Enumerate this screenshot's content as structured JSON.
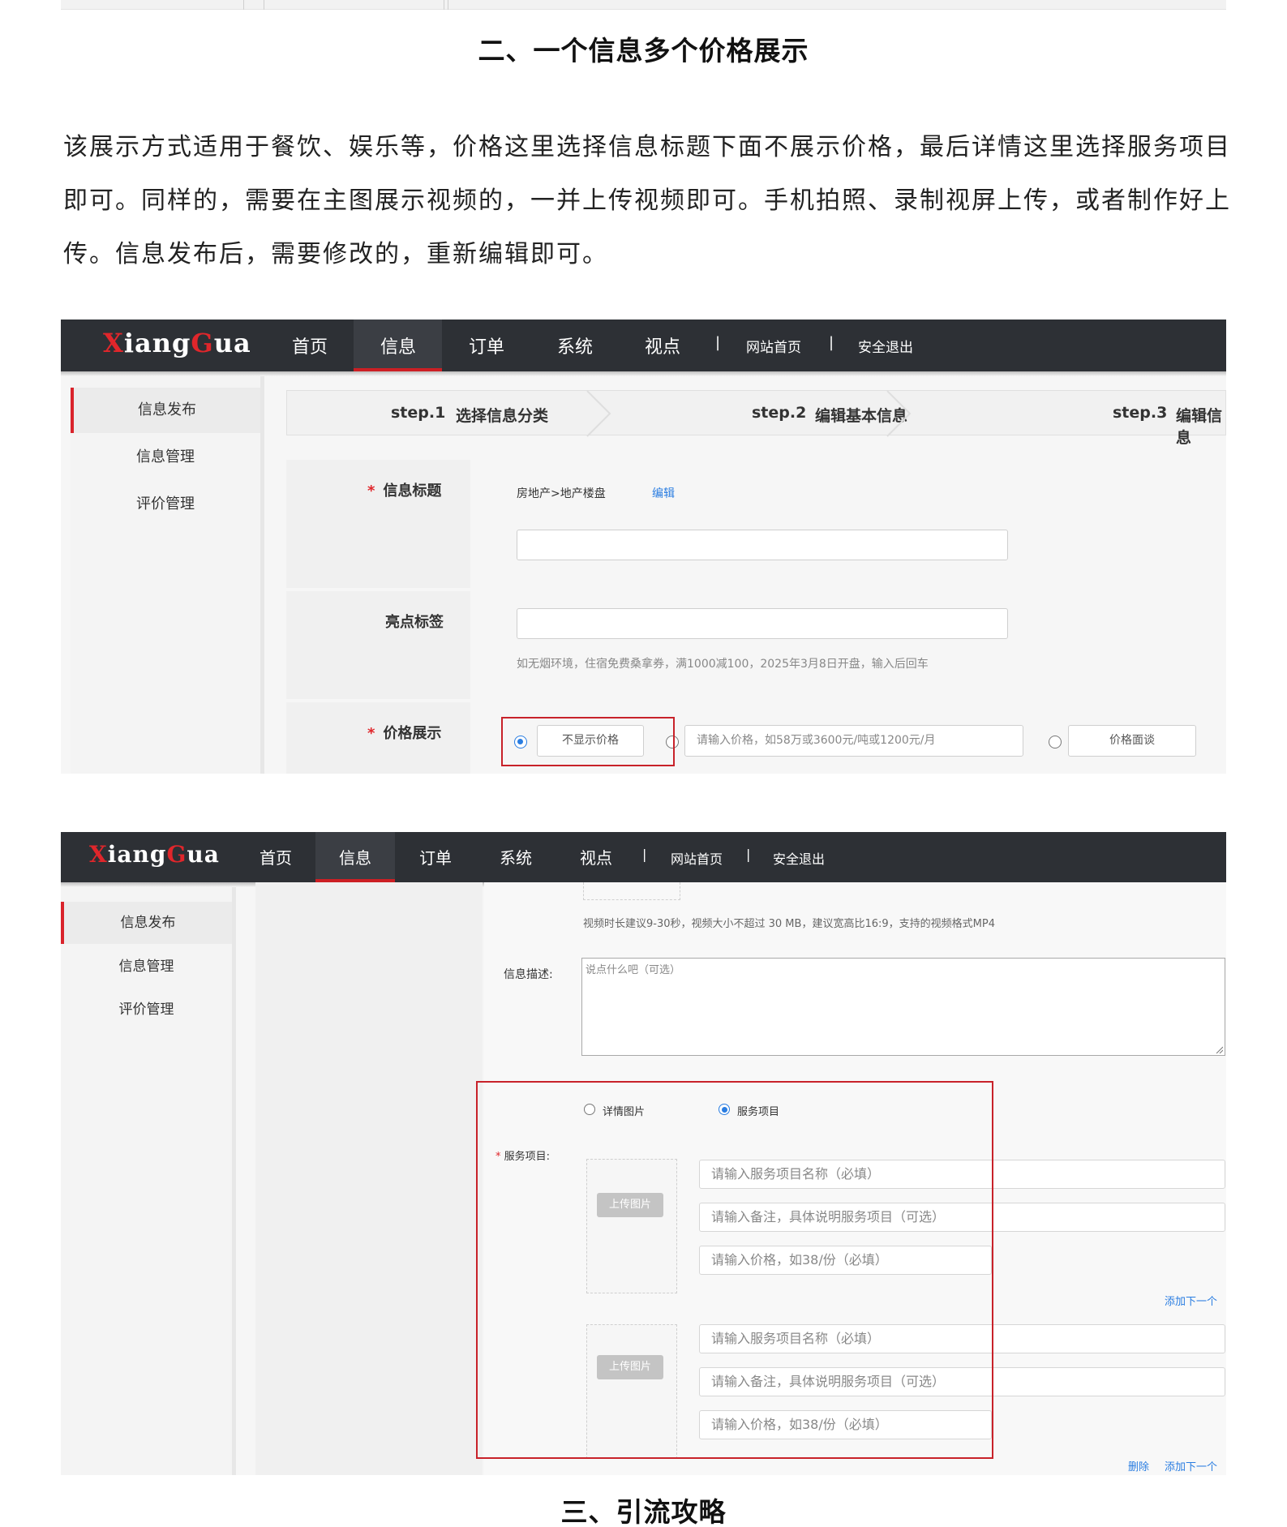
{
  "section2_title": "二、一个信息多个价格展示",
  "paragraph": {
    "line1": "该展示方式适用于餐饮、娱乐等，价格这里选择信息标题下面不展示价格，最后详情这里选择服务项目",
    "line2": "即可。同样的，需要在主图展示视频的，一并上传视频即可。手机拍照、录制视屏上传，或者制作好上",
    "line3": "传。信息发布后，需要修改的，重新编辑即可。"
  },
  "shot1": {
    "logo": {
      "x": "X",
      "mid": "iang",
      "g": "G",
      "end": "ua"
    },
    "nav": {
      "home": "首页",
      "info": "信息",
      "order": "订单",
      "system": "系统",
      "view": "视点",
      "sep": "|",
      "site_home": "网站首页",
      "logout": "安全退出"
    },
    "sidebar": {
      "publish": "信息发布",
      "manage": "信息管理",
      "review": "评价管理"
    },
    "steps": {
      "s1_num": "step.1",
      "s1_label": "选择信息分类",
      "s2_num": "step.2",
      "s2_label": "编辑基本信息",
      "s3_num": "step.3",
      "s3_label": "编辑信息"
    },
    "title_row": {
      "required": "*",
      "label": "信息标题",
      "category": "房地产>地产楼盘",
      "edit": "编辑"
    },
    "tag_row": {
      "label": "亮点标签",
      "hint": "如无烟环境，住宿免费桑拿券，满1000减100，2025年3月8日开盘，输入后回车"
    },
    "price_row": {
      "required": "*",
      "label": "价格展示",
      "opt_hide": "不显示价格",
      "price_placeholder": "请输入价格，如58万或3600元/吨或1200元/月",
      "opt_negotiable": "价格面谈"
    }
  },
  "shot2": {
    "logo": {
      "x": "X",
      "mid": "iang",
      "g": "G",
      "end": "ua"
    },
    "nav": {
      "home": "首页",
      "info": "信息",
      "order": "订单",
      "system": "系统",
      "view": "视点",
      "sep": "|",
      "site_home": "网站首页",
      "logout": "安全退出"
    },
    "sidebar": {
      "publish": "信息发布",
      "manage": "信息管理",
      "review": "评价管理"
    },
    "video_hint": "视频时长建议9-30秒，视频大小不超过 30 MB，建议宽高比16:9，支持的视频格式MP4",
    "desc_label": "信息描述:",
    "desc_placeholder": "说点什么吧（可选）",
    "detail_opt_image": "详情图片",
    "detail_opt_service": "服务项目",
    "service_required": "*",
    "service_label": "服务项目:",
    "upload_label": "上传图片",
    "item_name_placeholder": "请输入服务项目名称（必填）",
    "item_note_placeholder": "请输入备注，具体说明服务项目（可选）",
    "item_price_placeholder": "请输入价格，如38/份（必填）",
    "add_next": "添加下一个",
    "delete": "删除"
  },
  "section3_title": "三、引流攻略"
}
